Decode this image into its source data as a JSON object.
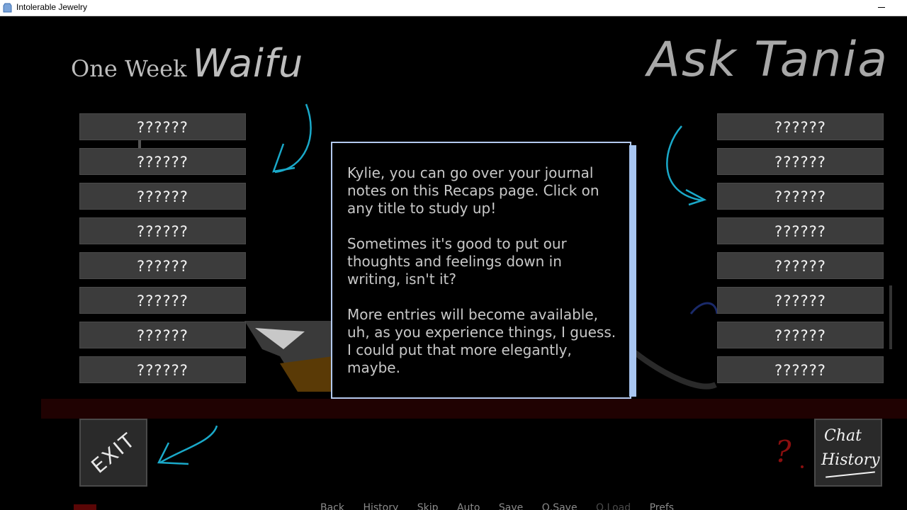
{
  "window": {
    "title": "Intolerable Jewelry"
  },
  "headings": {
    "left_small": "One Week",
    "left_big": "Waifu",
    "right": "Ask Tania"
  },
  "left_recaps": [
    "??????",
    "??????",
    "??????",
    "??????",
    "??????",
    "??????",
    "??????",
    "??????"
  ],
  "right_recaps": [
    "??????",
    "??????",
    "??????",
    "??????",
    "??????",
    "??????",
    "??????",
    "??????"
  ],
  "info": {
    "paragraphs": [
      "Kylie, you can go over your journal notes on this Recaps page. Click on any title to study up!",
      "Sometimes it's good to put our thoughts and feelings down in writing, isn't it?",
      "More entries will become available, uh, as you experience things, I guess. I could put that more elegantly, maybe."
    ]
  },
  "buttons": {
    "exit": "EXIT",
    "chat_line1": "Chat",
    "chat_line2": "History",
    "help": "?"
  },
  "quick_menu": [
    {
      "label": "Back",
      "enabled": true
    },
    {
      "label": "History",
      "enabled": true
    },
    {
      "label": "Skip",
      "enabled": true
    },
    {
      "label": "Auto",
      "enabled": true
    },
    {
      "label": "Save",
      "enabled": true
    },
    {
      "label": "Q.Save",
      "enabled": true
    },
    {
      "label": "Q.Load",
      "enabled": false
    },
    {
      "label": "Prefs",
      "enabled": true
    }
  ],
  "colors": {
    "arrow": "#1aa9c9",
    "box_border": "#b3c9ee",
    "recap_button": "#3c3c3c"
  }
}
